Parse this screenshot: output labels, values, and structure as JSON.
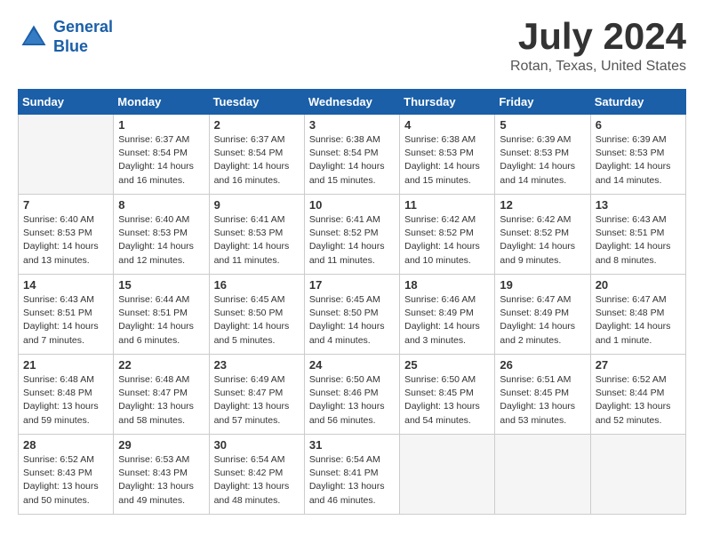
{
  "header": {
    "logo_line1": "General",
    "logo_line2": "Blue",
    "month_title": "July 2024",
    "location": "Rotan, Texas, United States"
  },
  "days_of_week": [
    "Sunday",
    "Monday",
    "Tuesday",
    "Wednesday",
    "Thursday",
    "Friday",
    "Saturday"
  ],
  "weeks": [
    [
      {
        "day": "",
        "info": ""
      },
      {
        "day": "1",
        "info": "Sunrise: 6:37 AM\nSunset: 8:54 PM\nDaylight: 14 hours\nand 16 minutes."
      },
      {
        "day": "2",
        "info": "Sunrise: 6:37 AM\nSunset: 8:54 PM\nDaylight: 14 hours\nand 16 minutes."
      },
      {
        "day": "3",
        "info": "Sunrise: 6:38 AM\nSunset: 8:54 PM\nDaylight: 14 hours\nand 15 minutes."
      },
      {
        "day": "4",
        "info": "Sunrise: 6:38 AM\nSunset: 8:53 PM\nDaylight: 14 hours\nand 15 minutes."
      },
      {
        "day": "5",
        "info": "Sunrise: 6:39 AM\nSunset: 8:53 PM\nDaylight: 14 hours\nand 14 minutes."
      },
      {
        "day": "6",
        "info": "Sunrise: 6:39 AM\nSunset: 8:53 PM\nDaylight: 14 hours\nand 14 minutes."
      }
    ],
    [
      {
        "day": "7",
        "info": "Sunrise: 6:40 AM\nSunset: 8:53 PM\nDaylight: 14 hours\nand 13 minutes."
      },
      {
        "day": "8",
        "info": "Sunrise: 6:40 AM\nSunset: 8:53 PM\nDaylight: 14 hours\nand 12 minutes."
      },
      {
        "day": "9",
        "info": "Sunrise: 6:41 AM\nSunset: 8:53 PM\nDaylight: 14 hours\nand 11 minutes."
      },
      {
        "day": "10",
        "info": "Sunrise: 6:41 AM\nSunset: 8:52 PM\nDaylight: 14 hours\nand 11 minutes."
      },
      {
        "day": "11",
        "info": "Sunrise: 6:42 AM\nSunset: 8:52 PM\nDaylight: 14 hours\nand 10 minutes."
      },
      {
        "day": "12",
        "info": "Sunrise: 6:42 AM\nSunset: 8:52 PM\nDaylight: 14 hours\nand 9 minutes."
      },
      {
        "day": "13",
        "info": "Sunrise: 6:43 AM\nSunset: 8:51 PM\nDaylight: 14 hours\nand 8 minutes."
      }
    ],
    [
      {
        "day": "14",
        "info": "Sunrise: 6:43 AM\nSunset: 8:51 PM\nDaylight: 14 hours\nand 7 minutes."
      },
      {
        "day": "15",
        "info": "Sunrise: 6:44 AM\nSunset: 8:51 PM\nDaylight: 14 hours\nand 6 minutes."
      },
      {
        "day": "16",
        "info": "Sunrise: 6:45 AM\nSunset: 8:50 PM\nDaylight: 14 hours\nand 5 minutes."
      },
      {
        "day": "17",
        "info": "Sunrise: 6:45 AM\nSunset: 8:50 PM\nDaylight: 14 hours\nand 4 minutes."
      },
      {
        "day": "18",
        "info": "Sunrise: 6:46 AM\nSunset: 8:49 PM\nDaylight: 14 hours\nand 3 minutes."
      },
      {
        "day": "19",
        "info": "Sunrise: 6:47 AM\nSunset: 8:49 PM\nDaylight: 14 hours\nand 2 minutes."
      },
      {
        "day": "20",
        "info": "Sunrise: 6:47 AM\nSunset: 8:48 PM\nDaylight: 14 hours\nand 1 minute."
      }
    ],
    [
      {
        "day": "21",
        "info": "Sunrise: 6:48 AM\nSunset: 8:48 PM\nDaylight: 13 hours\nand 59 minutes."
      },
      {
        "day": "22",
        "info": "Sunrise: 6:48 AM\nSunset: 8:47 PM\nDaylight: 13 hours\nand 58 minutes."
      },
      {
        "day": "23",
        "info": "Sunrise: 6:49 AM\nSunset: 8:47 PM\nDaylight: 13 hours\nand 57 minutes."
      },
      {
        "day": "24",
        "info": "Sunrise: 6:50 AM\nSunset: 8:46 PM\nDaylight: 13 hours\nand 56 minutes."
      },
      {
        "day": "25",
        "info": "Sunrise: 6:50 AM\nSunset: 8:45 PM\nDaylight: 13 hours\nand 54 minutes."
      },
      {
        "day": "26",
        "info": "Sunrise: 6:51 AM\nSunset: 8:45 PM\nDaylight: 13 hours\nand 53 minutes."
      },
      {
        "day": "27",
        "info": "Sunrise: 6:52 AM\nSunset: 8:44 PM\nDaylight: 13 hours\nand 52 minutes."
      }
    ],
    [
      {
        "day": "28",
        "info": "Sunrise: 6:52 AM\nSunset: 8:43 PM\nDaylight: 13 hours\nand 50 minutes."
      },
      {
        "day": "29",
        "info": "Sunrise: 6:53 AM\nSunset: 8:43 PM\nDaylight: 13 hours\nand 49 minutes."
      },
      {
        "day": "30",
        "info": "Sunrise: 6:54 AM\nSunset: 8:42 PM\nDaylight: 13 hours\nand 48 minutes."
      },
      {
        "day": "31",
        "info": "Sunrise: 6:54 AM\nSunset: 8:41 PM\nDaylight: 13 hours\nand 46 minutes."
      },
      {
        "day": "",
        "info": ""
      },
      {
        "day": "",
        "info": ""
      },
      {
        "day": "",
        "info": ""
      }
    ]
  ]
}
